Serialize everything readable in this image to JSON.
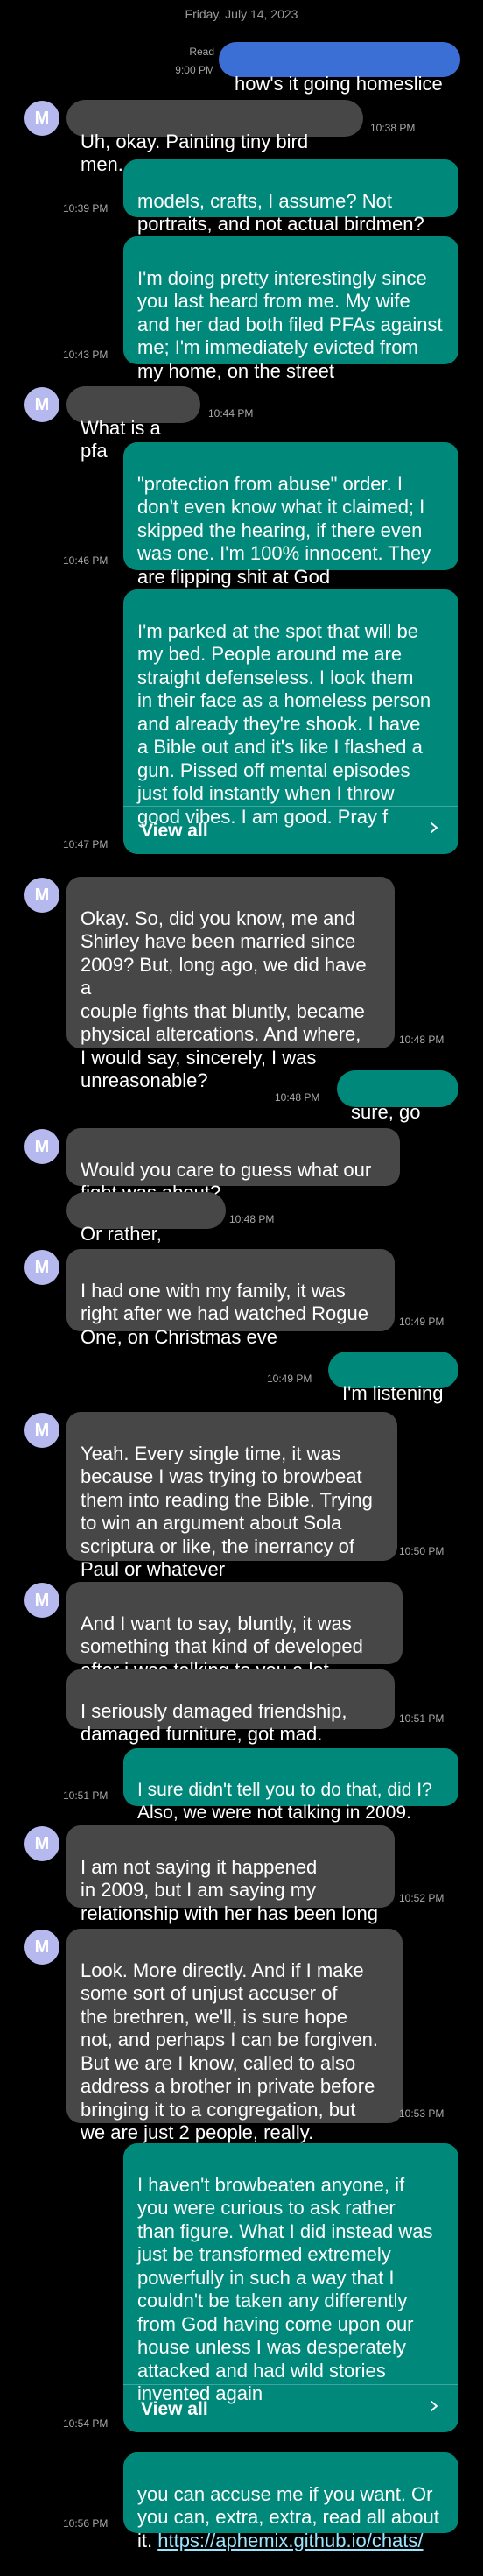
{
  "header": {
    "date": "Friday, July 14, 2023",
    "read_label": "Read",
    "read_time": "9:00 PM"
  },
  "contact": {
    "avatar_letter": "M"
  },
  "messages": [
    {
      "text": "how's it going homeslice",
      "time": ""
    },
    {
      "text": "Uh, okay. Painting tiny bird men.",
      "time": "10:38 PM"
    },
    {
      "text": "models, crafts, I assume? Not\nportraits, and not actual birdmen?",
      "time": "10:39 PM"
    },
    {
      "text": "I'm doing pretty interestingly since\nyou last heard from me. My wife\nand her dad both filed PFAs against\nme; I'm immediately evicted from\nmy home, on the street",
      "time": "10:43 PM"
    },
    {
      "text": "What is a pfa",
      "time": "10:44 PM"
    },
    {
      "text": "\"protection from abuse\" order. I\ndon't even know what it claimed; I\nskipped the hearing, if there even\nwas one. I'm 100% innocent. They\nare flipping shit at God",
      "time": "10:46 PM"
    },
    {
      "text": "I'm parked at the spot that will be\nmy bed. People around me are\nstraight defenseless. I look them\nin their face as a homeless person\nand already they're shook. I have\na Bible out and it's like I flashed a\ngun. Pissed off mental episodes\njust fold instantly when I throw\ngood vibes. I am good. Pray f",
      "time": "10:47 PM",
      "view_all": "View all"
    },
    {
      "text": "Okay. So, did you know, me and\nShirley have been married since\n2009? But, long ago, we did have a\ncouple fights that bluntly, became\nphysical altercations. And where,\nI would say, sincerely, I was\nunreasonable?",
      "time": "10:48 PM"
    },
    {
      "text": "sure, go on",
      "time": "10:48 PM"
    },
    {
      "text": "Would you care to guess what our\nfight was about?",
      "time": ""
    },
    {
      "text": "Or rather, fights",
      "time": "10:48 PM"
    },
    {
      "text": "I had one with my family, it was\nright after we had watched Rogue\nOne, on Christmas eve",
      "time": "10:49 PM"
    },
    {
      "text": "I'm listening",
      "time": "10:49 PM"
    },
    {
      "text": "Yeah. Every single time, it was\nbecause I was trying to browbeat\nthem into reading the Bible. Trying\nto win an argument about Sola\nscriptura or like, the inerrancy of\nPaul or whatever",
      "time": "10:50 PM"
    },
    {
      "text": "And I want to say, bluntly, it was\nsomething that kind of developed\nafter i was talking to you a lot.",
      "time": ""
    },
    {
      "text": "I seriously damaged friendship,\ndamaged furniture, got mad.",
      "time": "10:51 PM"
    },
    {
      "text": "I sure didn't tell you to do that, did I?\nAlso, we were not talking in 2009.",
      "time": "10:51 PM"
    },
    {
      "text": "I am not saying it happened\nin 2009, but I am saying my\nrelationship with her has been long",
      "time": "10:52 PM"
    },
    {
      "text": "Look. More directly. And if I make\nsome sort of unjust accuser of\nthe brethren, we'll, is sure hope\nnot, and perhaps I can be forgiven.\nBut we are I know, called to also\naddress a brother in private before\nbringing it to a congregation, but\nwe are just 2 people, really.",
      "time": "10:53 PM"
    },
    {
      "text": "I haven't browbeaten anyone, if\nyou were curious to ask rather\nthan figure. What I did instead was\njust be transformed extremely\npowerfully in such a way that I\ncouldn't be taken any differently\nfrom God having come upon our\nhouse unless I was desperately\nattacked and had wild stories\ninvented again",
      "time": "10:54 PM",
      "view_all": "View all"
    },
    {
      "text": "you can accuse me if you want. Or\nyou can, extra, extra, read all about\nit. ",
      "link": "https://aphemix.github.io/chats/",
      "time": "10:56 PM"
    }
  ],
  "colors": {
    "background": "#000000",
    "sent_bubble": "#00897b",
    "received_bubble": "#474747",
    "first_sent_bubble": "#3c6fd6",
    "avatar": "#b6b9ee",
    "timestamp": "#a8a8a8",
    "link": "#9ae6ff"
  }
}
